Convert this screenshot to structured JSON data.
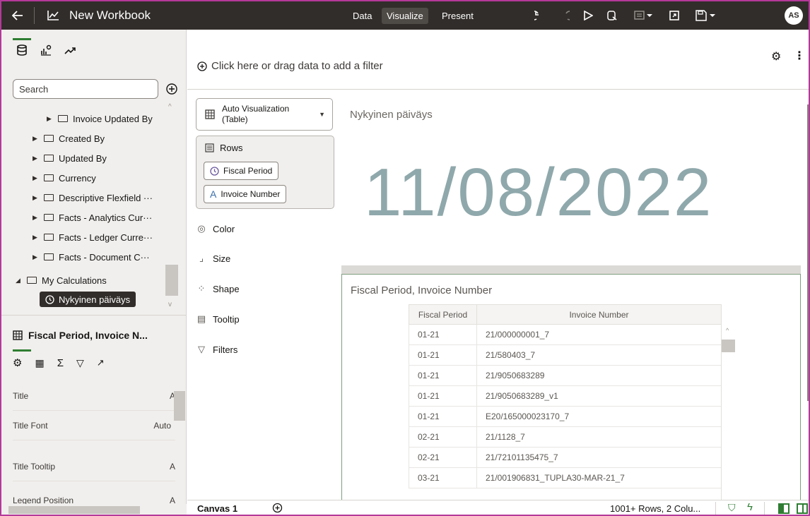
{
  "app": {
    "title": "New Workbook",
    "back_icon": "arrow-left-icon",
    "workbook_icon": "chart-workbook-icon"
  },
  "topbar": {
    "tabs": [
      {
        "label": "Data",
        "active": false
      },
      {
        "label": "Visualize",
        "active": true
      },
      {
        "label": "Present",
        "active": false
      }
    ],
    "icons": [
      "undo-icon",
      "redo-icon",
      "play-icon",
      "refresh-data-icon",
      "comment-icon",
      "export-icon",
      "save-icon"
    ],
    "avatar": "AS"
  },
  "left_panel": {
    "tab_icons": [
      "database-icon",
      "visualizations-icon",
      "analytics-icon"
    ],
    "search_placeholder": "Search",
    "add_icon": "plus-circle-icon",
    "tree": [
      {
        "label": "Invoice Updated By",
        "indent": 2,
        "type": "folder",
        "expanded": false
      },
      {
        "label": "Created By",
        "indent": 1,
        "type": "folder",
        "expanded": false
      },
      {
        "label": "Updated By",
        "indent": 1,
        "type": "folder",
        "expanded": false
      },
      {
        "label": "Currency",
        "indent": 1,
        "type": "folder",
        "expanded": false
      },
      {
        "label": "Descriptive Flexfield ···",
        "indent": 1,
        "type": "folder",
        "expanded": false
      },
      {
        "label": "Facts - Analytics Cur···",
        "indent": 1,
        "type": "folder",
        "expanded": false
      },
      {
        "label": "Facts - Ledger Curre···",
        "indent": 1,
        "type": "folder",
        "expanded": false
      },
      {
        "label": "Facts - Document C···",
        "indent": 1,
        "type": "folder",
        "expanded": false
      },
      {
        "label": "My Calculations",
        "indent": 0,
        "type": "folder",
        "expanded": true
      },
      {
        "label": "Nykyinen päiväys",
        "indent": 1,
        "type": "calculation",
        "selected": true
      }
    ],
    "properties": {
      "title": "Fiscal Period, Invoice N...",
      "tab_icons": [
        "settings-icon",
        "table-icon",
        "sigma-icon",
        "filter-icon",
        "analytics-icon"
      ],
      "rows": [
        {
          "label": "Title",
          "value": "A"
        },
        {
          "label": "Title Font",
          "value": "Auto"
        },
        {
          "label": "Title Tooltip",
          "value": "A"
        },
        {
          "label": "Legend Position",
          "value": "A"
        }
      ]
    }
  },
  "filter_bar": {
    "prompt": "Click here or drag data to add a filter",
    "add_icon": "plus-circle-icon",
    "icons": [
      "settings-gear-icon",
      "more-vertical-icon"
    ]
  },
  "grammar": {
    "viz_type": "Auto Visualization (Table)",
    "viz_type_line1": "Auto Visualization",
    "viz_type_line2": "(Table)",
    "rows_label": "Rows",
    "row_chips": [
      {
        "label": "Fiscal Period",
        "icon": "clock-icon"
      },
      {
        "label": "Invoice Number",
        "icon": "text-attribute-icon"
      }
    ],
    "items": [
      {
        "label": "Color",
        "icon": "palette-icon"
      },
      {
        "label": "Size",
        "icon": "size-icon"
      },
      {
        "label": "Shape",
        "icon": "shape-icon"
      },
      {
        "label": "Tooltip",
        "icon": "tooltip-icon"
      },
      {
        "label": "Filters",
        "icon": "filter-icon"
      }
    ]
  },
  "canvas": {
    "kpi_label": "Nykyinen päiväys",
    "kpi_value": "11/08/2022",
    "table": {
      "title": "Fiscal Period, Invoice Number",
      "columns": [
        "Fiscal Period",
        "Invoice Number"
      ],
      "rows": [
        [
          "01-21",
          "21/000000001_7"
        ],
        [
          "01-21",
          "21/580403_7"
        ],
        [
          "01-21",
          "21/9050683289"
        ],
        [
          "01-21",
          "21/9050683289_v1"
        ],
        [
          "01-21",
          "E20/165000023170_7"
        ],
        [
          "02-21",
          "21/1128_7"
        ],
        [
          "02-21",
          "21/72101135475_7"
        ],
        [
          "03-21",
          "21/001906831_TUPLA30-MAR-21_7"
        ]
      ]
    }
  },
  "bottom_bar": {
    "canvas_tab": "Canvas 1",
    "add_canvas_icon": "plus-circle-icon",
    "status": "1001+ Rows, 2 Colu...",
    "icons": [
      "data-quality-icon",
      "lightning-icon",
      "panel-left-icon",
      "panel-right-icon"
    ]
  },
  "colors": {
    "topbar_bg": "#312d2a",
    "kpi_text": "#8fa8ab",
    "accent_green": "#2e7d32",
    "frame_border": "#b5399a"
  }
}
